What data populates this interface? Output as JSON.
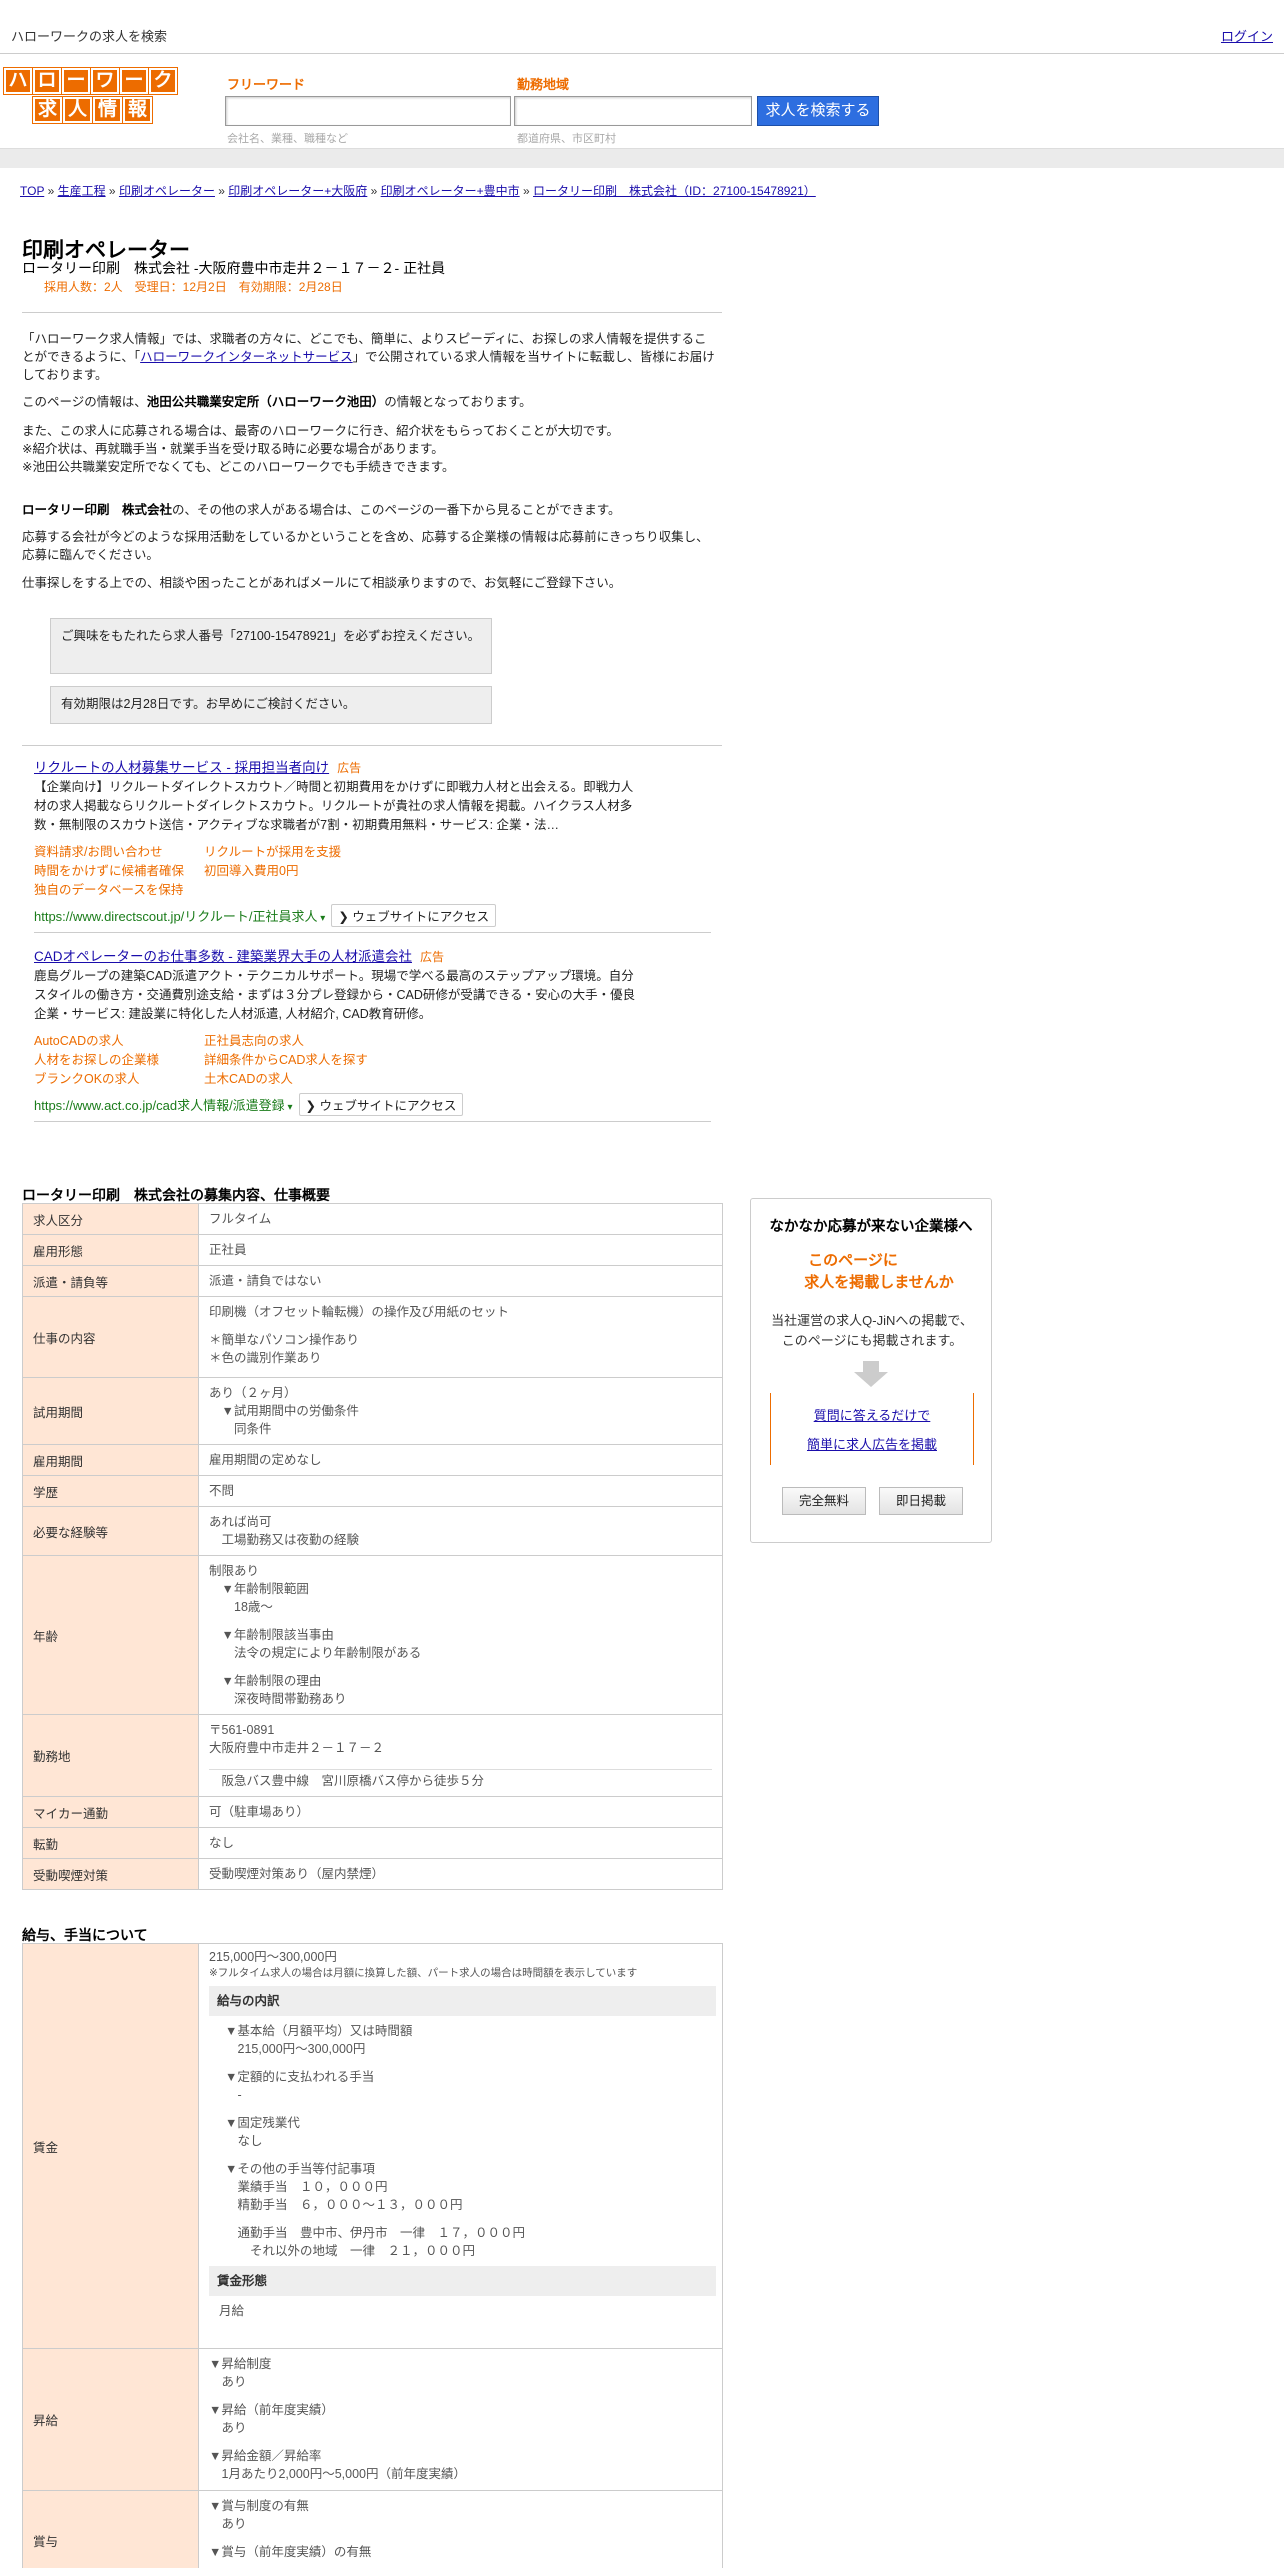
{
  "header": {
    "search_title": "ハローワークの求人を検索",
    "login": "ログイン"
  },
  "logo": {
    "line1": [
      "ハ",
      "ロ",
      "ー",
      "ワ",
      "ー",
      "ク"
    ],
    "line2": [
      "求",
      "人",
      "情",
      "報"
    ]
  },
  "search": {
    "freeword_label": "フリーワード",
    "freeword_placeholder": "会社名、業種、職種など",
    "area_label": "勤務地域",
    "area_placeholder": "都道府県、市区町村",
    "button": "求人を検索する"
  },
  "breadcrumb": [
    "TOP",
    "生産工程",
    "印刷オペレーター",
    "印刷オペレーター+大阪府",
    "印刷オペレーター+豊中市",
    "ロータリー印刷　株式会社（ID：27100-15478921）"
  ],
  "job": {
    "title": "印刷オペレーター",
    "company_line": "ロータリー印刷　株式会社 -大阪府豊中市走井２－１７－２- 正社員",
    "meta": "採用人数：2人　受理日：12月2日　有効期限：2月28日"
  },
  "intro": {
    "p1a": "「ハローワーク求人情報」では、求職者の方々に、どこでも、簡単に、よりスピーディに、お探しの求人情報を提供することができるように、「",
    "p1link": "ハローワークインターネットサービス",
    "p1b": "」で公開されている求人情報を当サイトに転載し、皆様にお届けしております。",
    "p2a": "このページの情報は、",
    "p2bold": "池田公共職業安定所（ハローワーク池田）",
    "p2b": "の情報となっております。",
    "p3": [
      "また、この求人に応募される場合は、最寄のハローワークに行き、紹介状をもらっておくことが大切です。",
      "※紹介状は、再就職手当・就業手当を受け取る時に必要な場合があります。",
      "※池田公共職業安定所でなくても、どこのハローワークでも手続きできます。"
    ],
    "p4bold": "ロータリー印刷　株式会社",
    "p4": "の、その他の求人がある場合は、このページの一番下から見ることができます。",
    "p5": "応募する会社が今どのような採用活動をしているかということを含め、応募する企業様の情報は応募前にきっちり収集し、応募に臨んでください。",
    "p6": "仕事探しをする上での、相談や困ったことがあればメールにて相談承りますので、お気軽にご登録下さい。"
  },
  "notes": {
    "n1": "ご興味をもたれたら求人番号「27100-15478921」を必ずお控えください。",
    "n2": "有効期限は2月28日です。お早めにご検討ください。"
  },
  "ads": [
    {
      "title": "リクルートの人材募集サービス - 採用担当者向け",
      "tag": "広告",
      "desc": "【企業向け】リクルートダイレクトスカウト／時間と初期費用をかけずに即戦力人材と出会える。即戦力人材の求人掲載ならリクルートダイレクトスカウト。リクルートが貴社の求人情報を掲載。ハイクラス人材多数・無制限のスカウト送信・アクティブな求職者が7割・初期費用無料・サービス: 企業・法…",
      "links": [
        [
          "資料請求/お問い合わせ",
          "リクルートが採用を支援"
        ],
        [
          "時間をかけずに候補者確保",
          "初回導入費用0円"
        ],
        [
          "独自のデータベースを保持",
          ""
        ]
      ],
      "url": "https://www.directscout.jp/リクルート/正社員求人",
      "visit": "ウェブサイトにアクセス"
    },
    {
      "title": "CADオペレーターのお仕事多数 - 建築業界大手の人材派遣会社",
      "tag": "広告",
      "desc": "鹿島グループの建築CAD派遣アクト・テクニカルサポート。現場で学べる最高のステップアップ環境。自分スタイルの働き方・交通費別途支給・まずは３分プレ登録から・CAD研修が受講できる・安心の大手・優良企業・サービス: 建設業に特化した人材派遣, 人材紹介, CAD教育研修。",
      "links": [
        [
          "AutoCADの求人",
          "正社員志向の求人"
        ],
        [
          "人材をお探しの企業様",
          "詳細条件からCAD求人を探す"
        ],
        [
          "ブランクOKの求人",
          "土木CADの求人"
        ]
      ],
      "url": "https://www.act.co.jp/cad求人情報/派遣登録",
      "visit": "ウェブサイトにアクセス"
    }
  ],
  "section1": {
    "title": "ロータリー印刷　株式会社の募集内容、仕事概要",
    "rows": [
      {
        "k": "求人区分",
        "v": [
          "フルタイム"
        ]
      },
      {
        "k": "雇用形態",
        "v": [
          "正社員"
        ]
      },
      {
        "k": "派遣・請負等",
        "v": [
          "派遣・請負ではない"
        ]
      },
      {
        "k": "仕事の内容",
        "v": [
          "印刷機（オフセット輪転機）の操作及び用紙のセット",
          "",
          "＊簡単なパソコン操作あり",
          "＊色の識別作業あり"
        ]
      },
      {
        "k": "試用期間",
        "v": [
          "あり（２ヶ月）",
          "　▼試用期間中の労働条件",
          "　　同条件"
        ]
      },
      {
        "k": "雇用期間",
        "v": [
          "雇用期間の定めなし"
        ]
      },
      {
        "k": "学歴",
        "v": [
          "不問"
        ]
      },
      {
        "k": "必要な経験等",
        "v": [
          "あれば尚可",
          "　工場勤務又は夜勤の経験"
        ]
      },
      {
        "k": "年齢",
        "v": [
          "制限あり",
          "　▼年齢制限範囲",
          "　　18歳〜",
          "",
          "　▼年齢制限該当事由",
          "　　法令の規定により年齢制限がある",
          "",
          "　▼年齢制限の理由",
          "　　深夜時間帯勤務あり"
        ]
      },
      {
        "k": "勤務地",
        "v": [
          "〒561-0891",
          "大阪府豊中市走井２－１７－２",
          "",
          "　阪急バス豊中線　宮川原橋バス停から徒歩５分"
        ]
      },
      {
        "k": "マイカー通勤",
        "v": [
          "可（駐車場あり）"
        ]
      },
      {
        "k": "転勤",
        "v": [
          "なし"
        ]
      },
      {
        "k": "受動喫煙対策",
        "v": [
          "受動喫煙対策あり（屋内禁煙）"
        ]
      }
    ]
  },
  "section2": {
    "title": "給与、手当について",
    "wage_label": "賃金",
    "wage_range": "215,000円〜300,000円",
    "wage_note": "※フルタイム求人の場合は月額に換算した額、パート求人の場合は時間額を表示しています",
    "breakdown_title": "給与の内訳",
    "breakdown": [
      "▼基本給（月額平均）又は時間額",
      "　215,000円〜300,000円",
      "",
      "▼定額的に支払われる手当",
      "　-",
      "",
      "▼固定残業代",
      "　なし",
      "",
      "▼その他の手当等付記事項",
      "　業績手当　１０，０００円",
      "　精勤手当　６，０００〜１３，０００円",
      "",
      "　通勤手当　豊中市、伊丹市　一律　１７，０００円",
      "　　それ以外の地域　一律　２１，０００円"
    ],
    "form_title": "賃金形態",
    "form_value": "月給",
    "raise_label": "昇給",
    "raise": [
      "▼昇給制度",
      "　あり",
      "",
      "▼昇給（前年度実績）",
      "　あり",
      "",
      "▼昇給金額／昇給率",
      "　1月あたり2,000円〜5,000円（前年度実績）"
    ],
    "bonus_label": "賞与",
    "bonus": [
      "▼賞与制度の有無",
      "　あり",
      "",
      "▼賞与（前年度実績）の有無"
    ]
  },
  "sidebar": {
    "heading": "なかなか応募が来ない企業様へ",
    "offer1": "このページに",
    "offer2": "求人を掲載しませんか",
    "desc1": "当社運営の求人Q-JiNへの掲載で、",
    "desc2": "このページにも掲載されます。",
    "link1": "質問に答えるだけで",
    "link2": "簡単に求人広告を掲載",
    "btn1": "完全無料",
    "btn2": "即日掲載"
  }
}
